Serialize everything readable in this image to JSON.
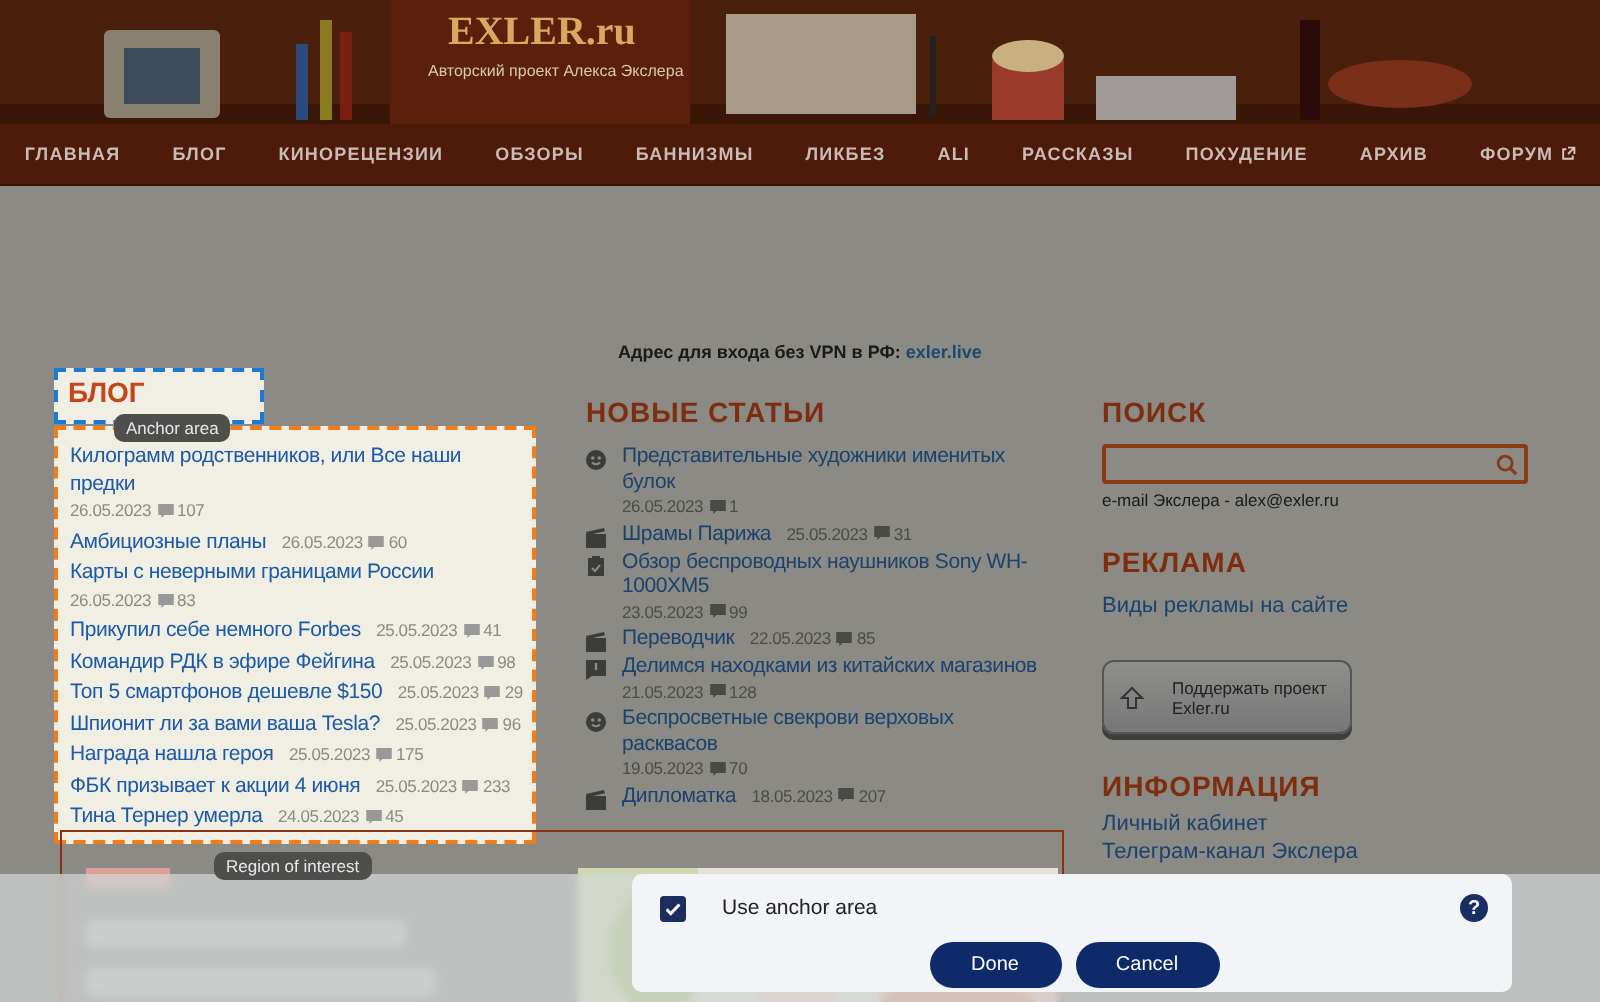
{
  "header": {
    "logo": "EXLER.ru",
    "tagline": "Авторский проект Алекса Экслера"
  },
  "nav": [
    {
      "label": "ГЛАВНАЯ",
      "external": false
    },
    {
      "label": "БЛОГ",
      "external": false
    },
    {
      "label": "КИНОРЕЦЕНЗИИ",
      "external": false
    },
    {
      "label": "ОБЗОРЫ",
      "external": false
    },
    {
      "label": "БАННИЗМЫ",
      "external": false
    },
    {
      "label": "ЛИКБЕЗ",
      "external": false
    },
    {
      "label": "ALI",
      "external": false
    },
    {
      "label": "РАССКАЗЫ",
      "external": false
    },
    {
      "label": "ПОХУДЕНИЕ",
      "external": false
    },
    {
      "label": "АРХИВ",
      "external": false
    },
    {
      "label": "ФОРУМ",
      "external": true
    }
  ],
  "notice": {
    "text": "Адрес для входа без VPN в РФ:",
    "link": "exler.live"
  },
  "blog": {
    "title": "БЛОГ",
    "items": [
      {
        "title": "Килограмм родственников, или Все наши предки",
        "date": "26.05.2023",
        "comments": "107"
      },
      {
        "title": "Амбициозные планы",
        "date": "26.05.2023",
        "comments": "60"
      },
      {
        "title": "Карты с неверными границами России",
        "date": "26.05.2023",
        "comments": "83"
      },
      {
        "title": "Прикупил себе немного Forbes",
        "date": "25.05.2023",
        "comments": "41"
      },
      {
        "title": "Командир РДК в эфире Фейгина",
        "date": "25.05.2023",
        "comments": "98"
      },
      {
        "title": "Топ 5 смартфонов дешевле $150",
        "date": "25.05.2023",
        "comments": "29"
      },
      {
        "title": "Шпионит ли за вами ваша Tesla?",
        "date": "25.05.2023",
        "comments": "96"
      },
      {
        "title": "Награда нашла героя",
        "date": "25.05.2023",
        "comments": "175"
      },
      {
        "title": "ФБК призывает к акции 4 июня",
        "date": "25.05.2023",
        "comments": "233"
      },
      {
        "title": "Тина Тернер умерла",
        "date": "24.05.2023",
        "comments": "45"
      }
    ]
  },
  "new_articles": {
    "title": "НОВЫЕ СТАТЬИ",
    "items": [
      {
        "kind": "smiley",
        "title": "Представительные художники именитых булок",
        "date": "26.05.2023",
        "comments": "1"
      },
      {
        "kind": "film",
        "title": "Шрамы Парижа",
        "date": "25.05.2023",
        "comments": "31"
      },
      {
        "kind": "review",
        "title": "Обзор беспроводных наушников Sony WH-1000XM5",
        "date": "23.05.2023",
        "comments": "99"
      },
      {
        "kind": "film",
        "title": "Переводчик",
        "date": "22.05.2023",
        "comments": "85"
      },
      {
        "kind": "note",
        "title": "Делимся находками из китайских магазинов",
        "date": "21.05.2023",
        "comments": "128"
      },
      {
        "kind": "smiley",
        "title": "Беспросветные свекрови верховых расквасов",
        "date": "19.05.2023",
        "comments": "70"
      },
      {
        "kind": "film",
        "title": "Дипломатка",
        "date": "18.05.2023",
        "comments": "207"
      }
    ]
  },
  "search": {
    "title": "ПОИСК"
  },
  "email": "e-mail Экслера - alex@exler.ru",
  "ads": {
    "title": "РЕКЛАМА",
    "link": "Виды рекламы на сайте"
  },
  "support_button": "Поддержать проект Exler.ru",
  "info": {
    "title": "ИНФОРМАЦИЯ",
    "links": [
      "Личный кабинет",
      "Телеграм-канал Экслера"
    ]
  },
  "annotations": {
    "anchor_label": "Anchor area",
    "region_label": "Region of interest"
  },
  "dialog": {
    "checkbox": {
      "label": "Use anchor area",
      "checked": true
    },
    "help": "?",
    "buttons": [
      "Done",
      "Cancel"
    ]
  }
}
